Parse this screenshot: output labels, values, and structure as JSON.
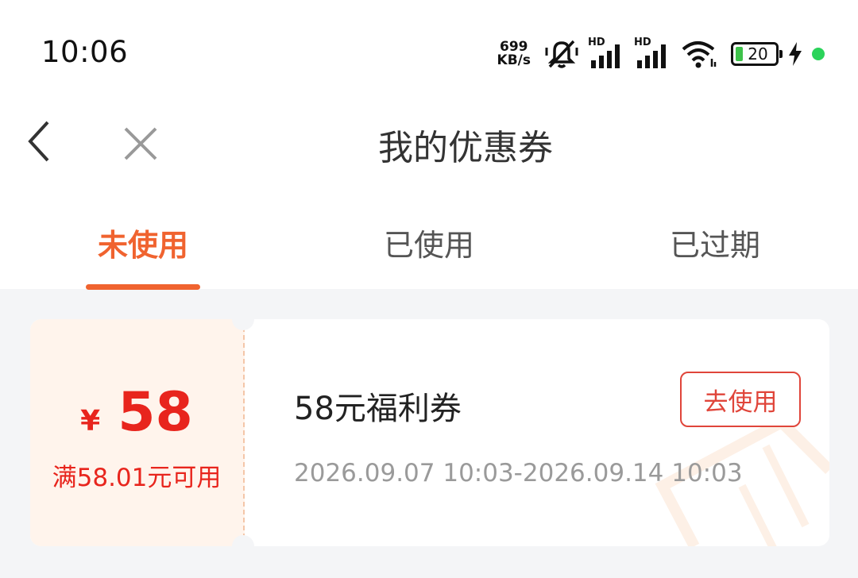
{
  "status_bar": {
    "time": "10:06",
    "net_speed_value": "699",
    "net_speed_unit": "KB/s",
    "network_1_label": "HD",
    "network_2_label": "HD",
    "battery_level": "20",
    "icons": [
      "mute-icon",
      "signal-icon",
      "signal-icon",
      "wifi-icon",
      "battery-icon",
      "charging-icon"
    ]
  },
  "nav": {
    "title": "我的优惠券",
    "back_icon": "chevron-left-icon",
    "close_icon": "close-icon"
  },
  "tabs": [
    {
      "label": "未使用",
      "active": true
    },
    {
      "label": "已使用",
      "active": false
    },
    {
      "label": "已过期",
      "active": false
    }
  ],
  "coupons": [
    {
      "currency": "¥",
      "amount": "58",
      "condition": "满58.01元可用",
      "name": "58元福利券",
      "validity": "2026.09.07 10:03-2026.09.14 10:03",
      "action_label": "去使用"
    }
  ],
  "colors": {
    "accent": "#f0632f",
    "amount_red": "#e8251d",
    "coupon_left_bg": "#fff4ec",
    "page_bg": "#f4f5f7"
  }
}
